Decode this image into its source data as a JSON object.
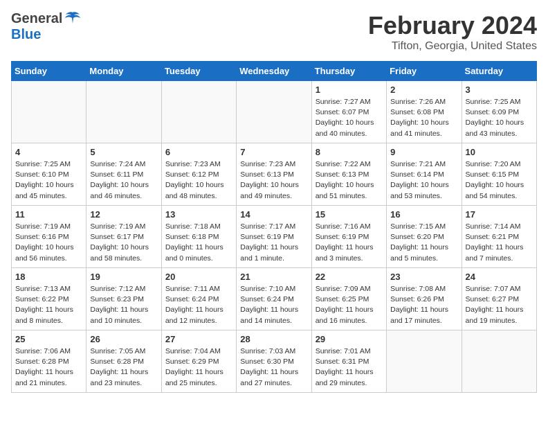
{
  "header": {
    "logo_general": "General",
    "logo_blue": "Blue",
    "title": "February 2024",
    "subtitle": "Tifton, Georgia, United States"
  },
  "columns": [
    "Sunday",
    "Monday",
    "Tuesday",
    "Wednesday",
    "Thursday",
    "Friday",
    "Saturday"
  ],
  "weeks": [
    [
      {
        "day": "",
        "info": ""
      },
      {
        "day": "",
        "info": ""
      },
      {
        "day": "",
        "info": ""
      },
      {
        "day": "",
        "info": ""
      },
      {
        "day": "1",
        "info": "Sunrise: 7:27 AM\nSunset: 6:07 PM\nDaylight: 10 hours\nand 40 minutes."
      },
      {
        "day": "2",
        "info": "Sunrise: 7:26 AM\nSunset: 6:08 PM\nDaylight: 10 hours\nand 41 minutes."
      },
      {
        "day": "3",
        "info": "Sunrise: 7:25 AM\nSunset: 6:09 PM\nDaylight: 10 hours\nand 43 minutes."
      }
    ],
    [
      {
        "day": "4",
        "info": "Sunrise: 7:25 AM\nSunset: 6:10 PM\nDaylight: 10 hours\nand 45 minutes."
      },
      {
        "day": "5",
        "info": "Sunrise: 7:24 AM\nSunset: 6:11 PM\nDaylight: 10 hours\nand 46 minutes."
      },
      {
        "day": "6",
        "info": "Sunrise: 7:23 AM\nSunset: 6:12 PM\nDaylight: 10 hours\nand 48 minutes."
      },
      {
        "day": "7",
        "info": "Sunrise: 7:23 AM\nSunset: 6:13 PM\nDaylight: 10 hours\nand 49 minutes."
      },
      {
        "day": "8",
        "info": "Sunrise: 7:22 AM\nSunset: 6:13 PM\nDaylight: 10 hours\nand 51 minutes."
      },
      {
        "day": "9",
        "info": "Sunrise: 7:21 AM\nSunset: 6:14 PM\nDaylight: 10 hours\nand 53 minutes."
      },
      {
        "day": "10",
        "info": "Sunrise: 7:20 AM\nSunset: 6:15 PM\nDaylight: 10 hours\nand 54 minutes."
      }
    ],
    [
      {
        "day": "11",
        "info": "Sunrise: 7:19 AM\nSunset: 6:16 PM\nDaylight: 10 hours\nand 56 minutes."
      },
      {
        "day": "12",
        "info": "Sunrise: 7:19 AM\nSunset: 6:17 PM\nDaylight: 10 hours\nand 58 minutes."
      },
      {
        "day": "13",
        "info": "Sunrise: 7:18 AM\nSunset: 6:18 PM\nDaylight: 11 hours\nand 0 minutes."
      },
      {
        "day": "14",
        "info": "Sunrise: 7:17 AM\nSunset: 6:19 PM\nDaylight: 11 hours\nand 1 minute."
      },
      {
        "day": "15",
        "info": "Sunrise: 7:16 AM\nSunset: 6:19 PM\nDaylight: 11 hours\nand 3 minutes."
      },
      {
        "day": "16",
        "info": "Sunrise: 7:15 AM\nSunset: 6:20 PM\nDaylight: 11 hours\nand 5 minutes."
      },
      {
        "day": "17",
        "info": "Sunrise: 7:14 AM\nSunset: 6:21 PM\nDaylight: 11 hours\nand 7 minutes."
      }
    ],
    [
      {
        "day": "18",
        "info": "Sunrise: 7:13 AM\nSunset: 6:22 PM\nDaylight: 11 hours\nand 8 minutes."
      },
      {
        "day": "19",
        "info": "Sunrise: 7:12 AM\nSunset: 6:23 PM\nDaylight: 11 hours\nand 10 minutes."
      },
      {
        "day": "20",
        "info": "Sunrise: 7:11 AM\nSunset: 6:24 PM\nDaylight: 11 hours\nand 12 minutes."
      },
      {
        "day": "21",
        "info": "Sunrise: 7:10 AM\nSunset: 6:24 PM\nDaylight: 11 hours\nand 14 minutes."
      },
      {
        "day": "22",
        "info": "Sunrise: 7:09 AM\nSunset: 6:25 PM\nDaylight: 11 hours\nand 16 minutes."
      },
      {
        "day": "23",
        "info": "Sunrise: 7:08 AM\nSunset: 6:26 PM\nDaylight: 11 hours\nand 17 minutes."
      },
      {
        "day": "24",
        "info": "Sunrise: 7:07 AM\nSunset: 6:27 PM\nDaylight: 11 hours\nand 19 minutes."
      }
    ],
    [
      {
        "day": "25",
        "info": "Sunrise: 7:06 AM\nSunset: 6:28 PM\nDaylight: 11 hours\nand 21 minutes."
      },
      {
        "day": "26",
        "info": "Sunrise: 7:05 AM\nSunset: 6:28 PM\nDaylight: 11 hours\nand 23 minutes."
      },
      {
        "day": "27",
        "info": "Sunrise: 7:04 AM\nSunset: 6:29 PM\nDaylight: 11 hours\nand 25 minutes."
      },
      {
        "day": "28",
        "info": "Sunrise: 7:03 AM\nSunset: 6:30 PM\nDaylight: 11 hours\nand 27 minutes."
      },
      {
        "day": "29",
        "info": "Sunrise: 7:01 AM\nSunset: 6:31 PM\nDaylight: 11 hours\nand 29 minutes."
      },
      {
        "day": "",
        "info": ""
      },
      {
        "day": "",
        "info": ""
      }
    ]
  ]
}
